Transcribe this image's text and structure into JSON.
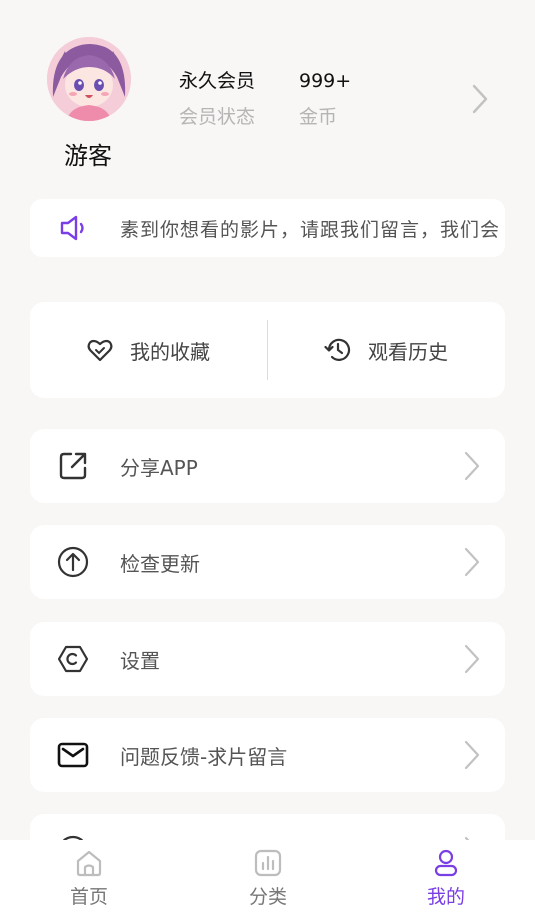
{
  "profile": {
    "username": "游客",
    "vip_value": "永久会员",
    "vip_label": "会员状态",
    "coins_value": "999+",
    "coins_label": "金币"
  },
  "notice": {
    "text": "素到你想看的影片，请跟我们留言，我们会"
  },
  "shortcuts": {
    "favorites_label": "我的收藏",
    "history_label": "观看历史"
  },
  "menu": {
    "items": [
      {
        "label": "分享APP",
        "icon": "share-icon"
      },
      {
        "label": "检查更新",
        "icon": "update-icon"
      },
      {
        "label": "设置",
        "icon": "settings-icon"
      },
      {
        "label": "问题反馈-求片留言",
        "icon": "mail-icon"
      },
      {
        "label": "",
        "icon": "info-icon"
      }
    ]
  },
  "nav": {
    "home_label": "首页",
    "category_label": "分类",
    "mine_label": "我的",
    "active": "mine"
  },
  "colors": {
    "accent": "#7a3fe4",
    "background": "#f8f7f6",
    "card": "#ffffff",
    "muted_text": "#b5b5b5"
  }
}
